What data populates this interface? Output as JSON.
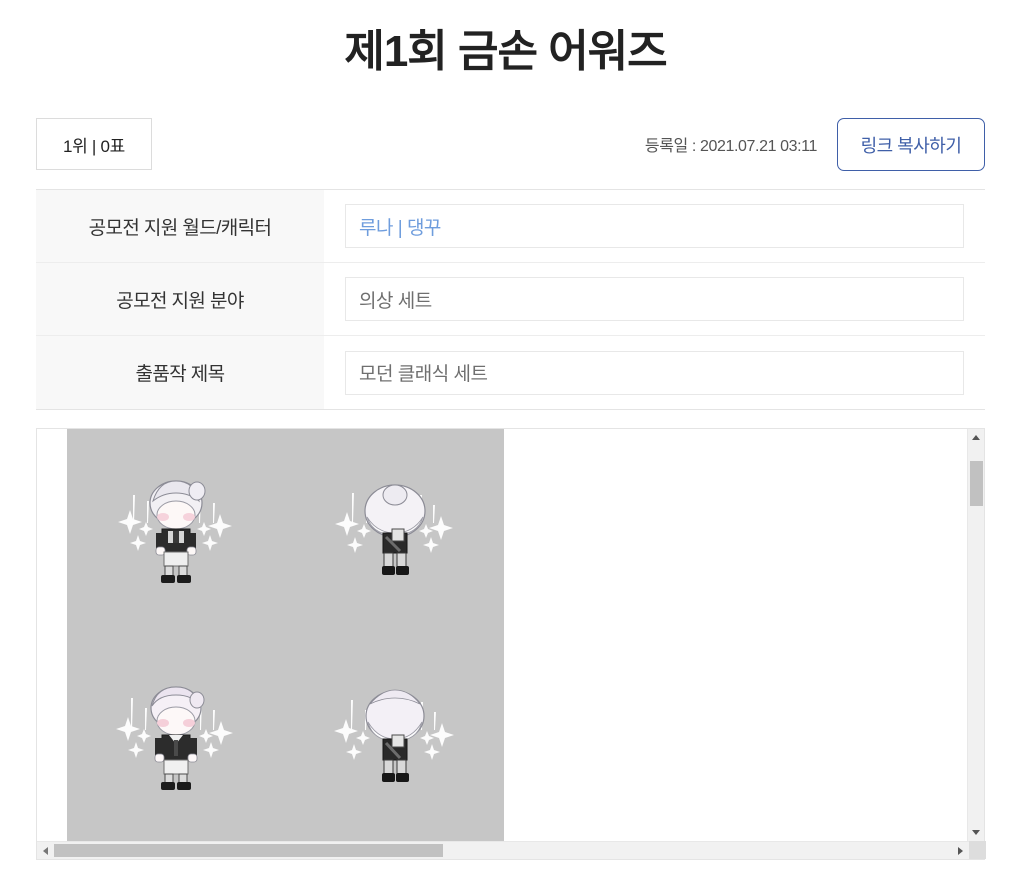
{
  "header": {
    "title": "제1회 금손 어워즈"
  },
  "meta": {
    "rank_badge": "1위  |  0표",
    "registered_label": "등록일 : 2021.07.21 03:11",
    "copy_link_label": "링크 복사하기",
    "accent_color": "#3f5fa8",
    "link_color": "#6f9ddd"
  },
  "info": {
    "rows": [
      {
        "label": "공모전 지원 월드/캐릭터",
        "value": "루나 | 댕꾸",
        "is_link": true
      },
      {
        "label": "공모전 지원 분야",
        "value": "의상 세트",
        "is_link": false
      },
      {
        "label": "출품작 제목",
        "value": "모던 클래식 세트",
        "is_link": false
      }
    ]
  },
  "viewer": {
    "background_color": "#c6c6c6",
    "sprites": [
      {
        "name": "front-facing-character-bun-hair",
        "facing": "front"
      },
      {
        "name": "back-facing-character-bun-hair",
        "facing": "back"
      },
      {
        "name": "front-facing-character-short-hair",
        "facing": "front"
      },
      {
        "name": "back-facing-character-short-hair",
        "facing": "back"
      }
    ],
    "v_scrollbar": {
      "up_arrow": "▲",
      "down_arrow": "▼"
    },
    "h_scrollbar": {
      "left_arrow": "◀",
      "right_arrow": "▶"
    }
  }
}
